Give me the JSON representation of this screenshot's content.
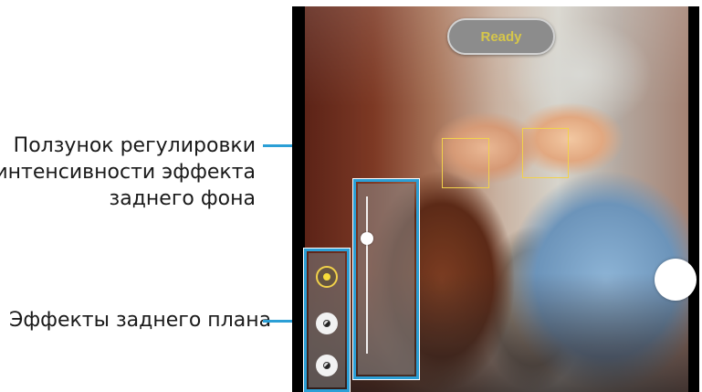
{
  "annotations": {
    "slider_label_lines": [
      "Ползунок регулировки",
      "интенсивности эффекта",
      "заднего фона"
    ],
    "effects_label": "Эффекты заднего плана",
    "callout_color": "#2b9fd6"
  },
  "camera": {
    "status_badge": "Ready",
    "badge_text_color": "#d6c64a",
    "face_box_color": "#f2d24a",
    "intensity_slider": {
      "value": 0.73
    },
    "effects": [
      {
        "icon": "effect-selected-icon",
        "selected": true
      },
      {
        "icon": "effect-option-icon",
        "selected": false
      },
      {
        "icon": "effect-option-icon",
        "selected": false
      }
    ]
  }
}
